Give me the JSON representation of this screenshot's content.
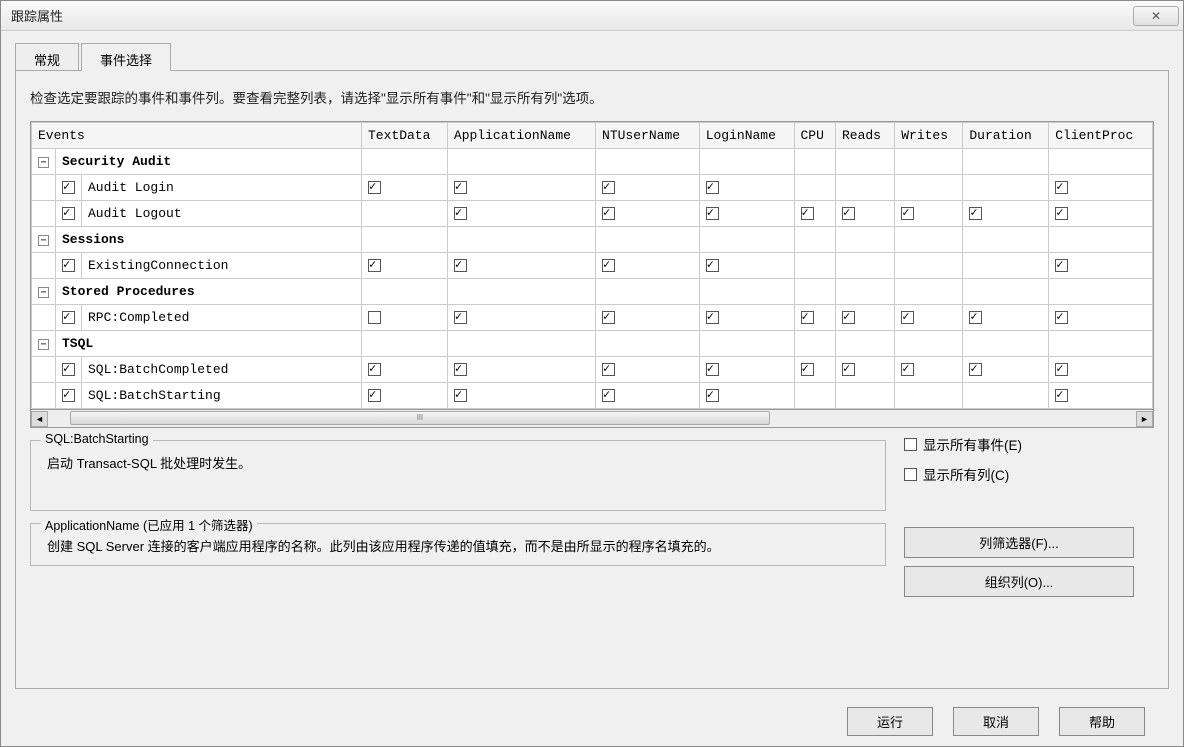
{
  "window": {
    "title": "跟踪属性",
    "close_glyph": "✕"
  },
  "tabs": {
    "general": "常规",
    "events": "事件选择"
  },
  "instruction": "检查选定要跟踪的事件和事件列。要查看完整列表，请选择\"显示所有事件\"和\"显示所有列\"选项。",
  "columns": [
    "Events",
    "TextData",
    "ApplicationName",
    "NTUserName",
    "LoginName",
    "CPU",
    "Reads",
    "Writes",
    "Duration",
    "ClientProc"
  ],
  "groups": [
    {
      "name": "Security Audit",
      "rows": [
        {
          "name": "Audit Login",
          "enabled": true,
          "cells": [
            true,
            true,
            true,
            true,
            null,
            null,
            null,
            null,
            true
          ]
        },
        {
          "name": "Audit Logout",
          "enabled": true,
          "cells": [
            null,
            true,
            true,
            true,
            true,
            true,
            true,
            true,
            true
          ]
        }
      ]
    },
    {
      "name": "Sessions",
      "rows": [
        {
          "name": "ExistingConnection",
          "enabled": true,
          "cells": [
            true,
            true,
            true,
            true,
            null,
            null,
            null,
            null,
            true
          ]
        }
      ]
    },
    {
      "name": "Stored Procedures",
      "rows": [
        {
          "name": "RPC:Completed",
          "enabled": true,
          "cells": [
            false,
            true,
            true,
            true,
            true,
            true,
            true,
            true,
            true
          ]
        }
      ]
    },
    {
      "name": "TSQL",
      "rows": [
        {
          "name": "SQL:BatchCompleted",
          "enabled": true,
          "cells": [
            true,
            true,
            true,
            true,
            true,
            true,
            true,
            true,
            true
          ]
        },
        {
          "name": "SQL:BatchStarting",
          "enabled": true,
          "cells": [
            true,
            true,
            true,
            true,
            null,
            null,
            null,
            null,
            true
          ]
        }
      ]
    }
  ],
  "desc1": {
    "legend": "SQL:BatchStarting",
    "text": "启动 Transact-SQL 批处理时发生。"
  },
  "options": {
    "show_all_events": "显示所有事件(E)",
    "show_all_columns": "显示所有列(C)"
  },
  "desc2": {
    "legend": "ApplicationName (已应用 1 个筛选器)",
    "text": "创建 SQL Server 连接的客户端应用程序的名称。此列由该应用程序传递的值填充，而不是由所显示的程序名填充的。"
  },
  "buttons": {
    "column_filter": "列筛选器(F)...",
    "organize": "组织列(O)...",
    "run": "运行",
    "cancel": "取消",
    "help": "帮助"
  },
  "expander_glyph": "−"
}
